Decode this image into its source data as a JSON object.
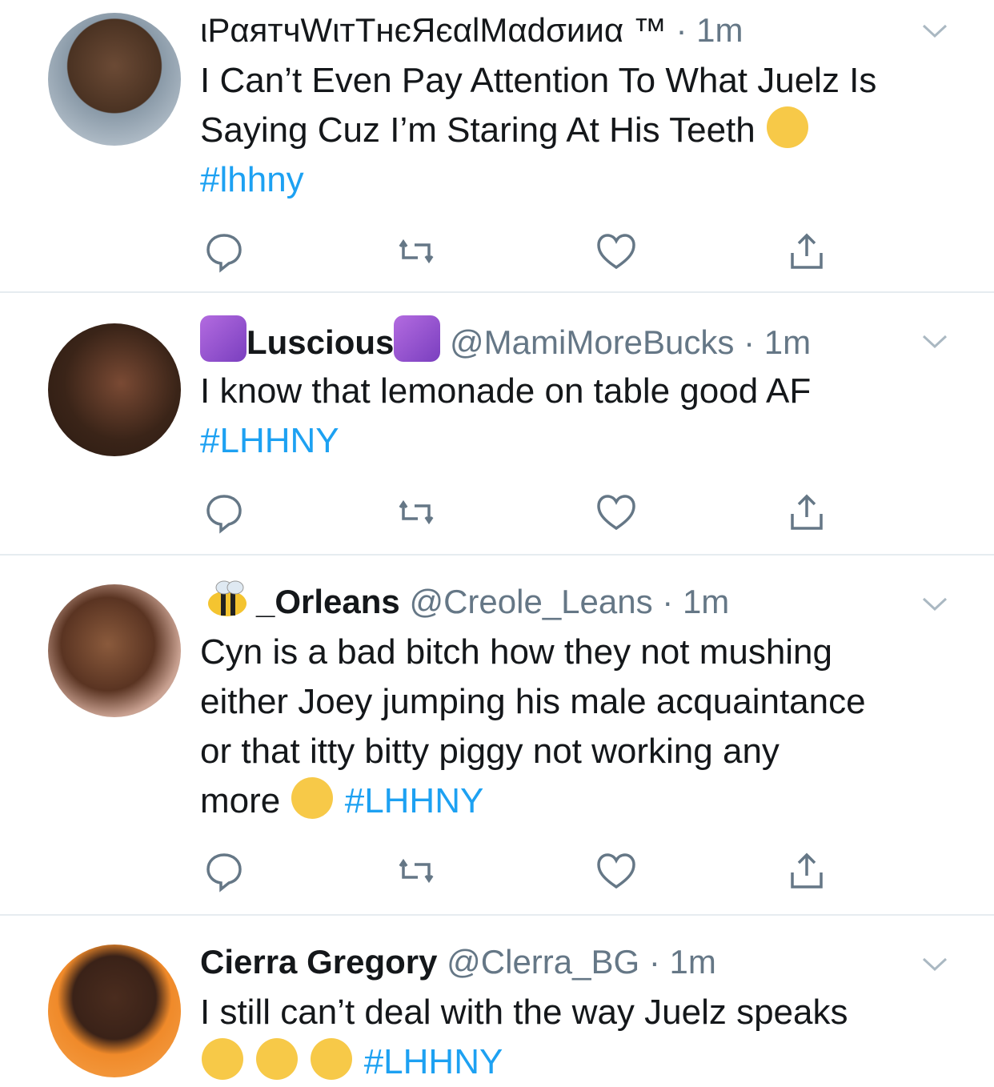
{
  "colors": {
    "hashtag": "#1da1f2",
    "secondary_text": "#657786",
    "divider": "#e6ecf0",
    "icon": "#657786"
  },
  "tweets": [
    {
      "display_name": "ιPαятчWιтTнєЯєαlMαdσииα ™",
      "handle": "",
      "dot": "·",
      "time": "1m",
      "text_lines": [
        "I Can’t Even Pay Attention To What Juelz Is",
        "Saying Cuz I’m Staring At His Teeth"
      ],
      "emoji": "tears-of-joy-emoji",
      "hashtag": "#lhhny"
    },
    {
      "display_name": "Luscious",
      "handle": "@MamiMoreBucks",
      "dot": "·",
      "time": "1m",
      "text_lines": [
        "I know that lemonade on table good AF"
      ],
      "hashtag": "#LHHNY"
    },
    {
      "display_name": "_Orleans",
      "handle": "@Creole_Leans",
      "dot": "·",
      "time": "1m",
      "text_lines": [
        "Cyn is a bad bitch how they not mushing",
        "either Joey jumping his male acquaintance",
        "or that itty bitty piggy not working any",
        "more"
      ],
      "emoji": "eye-roll-emoji",
      "hashtag": "#LHHNY"
    },
    {
      "display_name": "Cierra Gregory",
      "handle": "@Clerra_BG",
      "dot": "·",
      "time": "1m",
      "text_lines": [
        "I still can’t deal with the way Juelz speaks"
      ],
      "emoji": "confounded-emoji",
      "hashtag": "#LHHNY"
    }
  ]
}
